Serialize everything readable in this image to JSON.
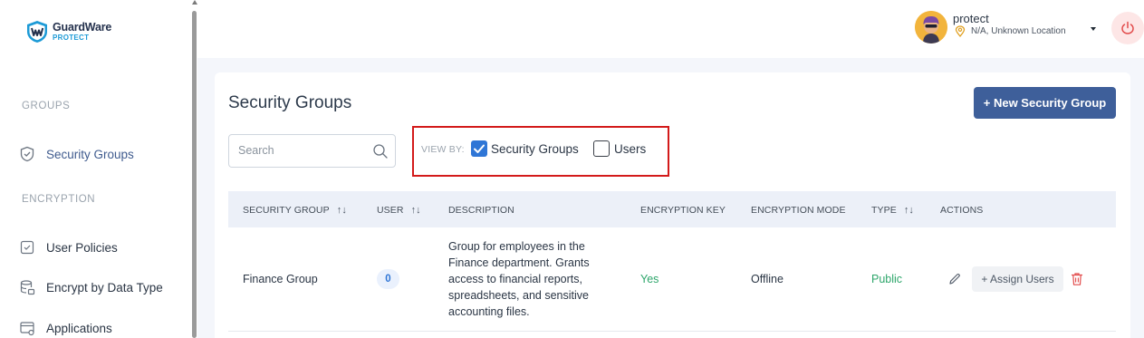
{
  "brand": {
    "name": "GuardWare",
    "sub": "PROTECT"
  },
  "sidebar": {
    "sections": [
      {
        "label": "GROUPS"
      },
      {
        "label": "ENCRYPTION"
      }
    ],
    "items": [
      {
        "label": "Security Groups",
        "icon": "shield-check-icon"
      },
      {
        "label": "User Policies",
        "icon": "clipboard-check-icon"
      },
      {
        "label": "Encrypt by Data Type",
        "icon": "database-lock-icon"
      },
      {
        "label": "Applications",
        "icon": "app-window-icon"
      }
    ]
  },
  "user": {
    "name": "protect",
    "location": "N/A, Unknown Location"
  },
  "page": {
    "title": "Security Groups",
    "new_button": "+ New Security Group",
    "search_placeholder": "Search",
    "viewby_label": "VIEW BY:",
    "view_options": [
      {
        "label": "Security Groups",
        "checked": true
      },
      {
        "label": "Users",
        "checked": false
      }
    ]
  },
  "table": {
    "headers": [
      "SECURITY GROUP",
      "USER",
      "DESCRIPTION",
      "ENCRYPTION KEY",
      "ENCRYPTION MODE",
      "TYPE",
      "ACTIONS"
    ],
    "sort_glyph": "↑↓",
    "rows": [
      {
        "group": "Finance Group",
        "users": "0",
        "description": "Group for employees in the Finance department. Grants access to financial reports, spreadsheets, and sensitive accounting files.",
        "encryption_key": "Yes",
        "encryption_mode": "Offline",
        "type": "Public",
        "assign_label": "+ Assign Users"
      }
    ]
  },
  "colors": {
    "accent": "#3e5f9a",
    "highlight_border": "#d31a1a",
    "success": "#2ea66b",
    "checkbox": "#2f76d6"
  }
}
